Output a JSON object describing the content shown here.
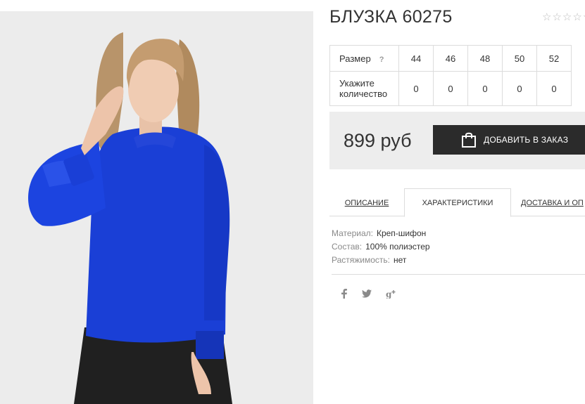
{
  "product": {
    "title": "БЛУЗКА 60275",
    "rating_stars": 5,
    "image_alt": "blue-blouse-photo"
  },
  "size_table": {
    "size_label": "Размер",
    "help_symbol": "?",
    "sizes": [
      "44",
      "46",
      "48",
      "50",
      "52"
    ],
    "quantity_label": "Укажите количество",
    "quantities": [
      "0",
      "0",
      "0",
      "0",
      "0"
    ]
  },
  "purchase": {
    "price": "899 руб",
    "add_button_label": "ДОБАВИТЬ В ЗАКАЗ"
  },
  "tabs": [
    {
      "label": "ОПИСАНИЕ",
      "active": false
    },
    {
      "label": "ХАРАКТЕРИСТИКИ",
      "active": true
    },
    {
      "label": "ДОСТАВКА И ОП",
      "active": false
    }
  ],
  "specs": [
    {
      "key": "Материал:",
      "value": "Креп-шифон"
    },
    {
      "key": "Состав:",
      "value": "100% полиэстер"
    },
    {
      "key": "Растяжимость:",
      "value": "нет"
    }
  ],
  "social": [
    {
      "icon": "facebook-icon",
      "glyph": "f"
    },
    {
      "icon": "twitter-icon",
      "glyph": "🐦"
    },
    {
      "icon": "google-plus-icon",
      "glyph": "g+"
    }
  ],
  "colors": {
    "accent_button": "#2b2b2b",
    "blouse": "#1a3fd6",
    "photo_bg": "#ececec"
  }
}
